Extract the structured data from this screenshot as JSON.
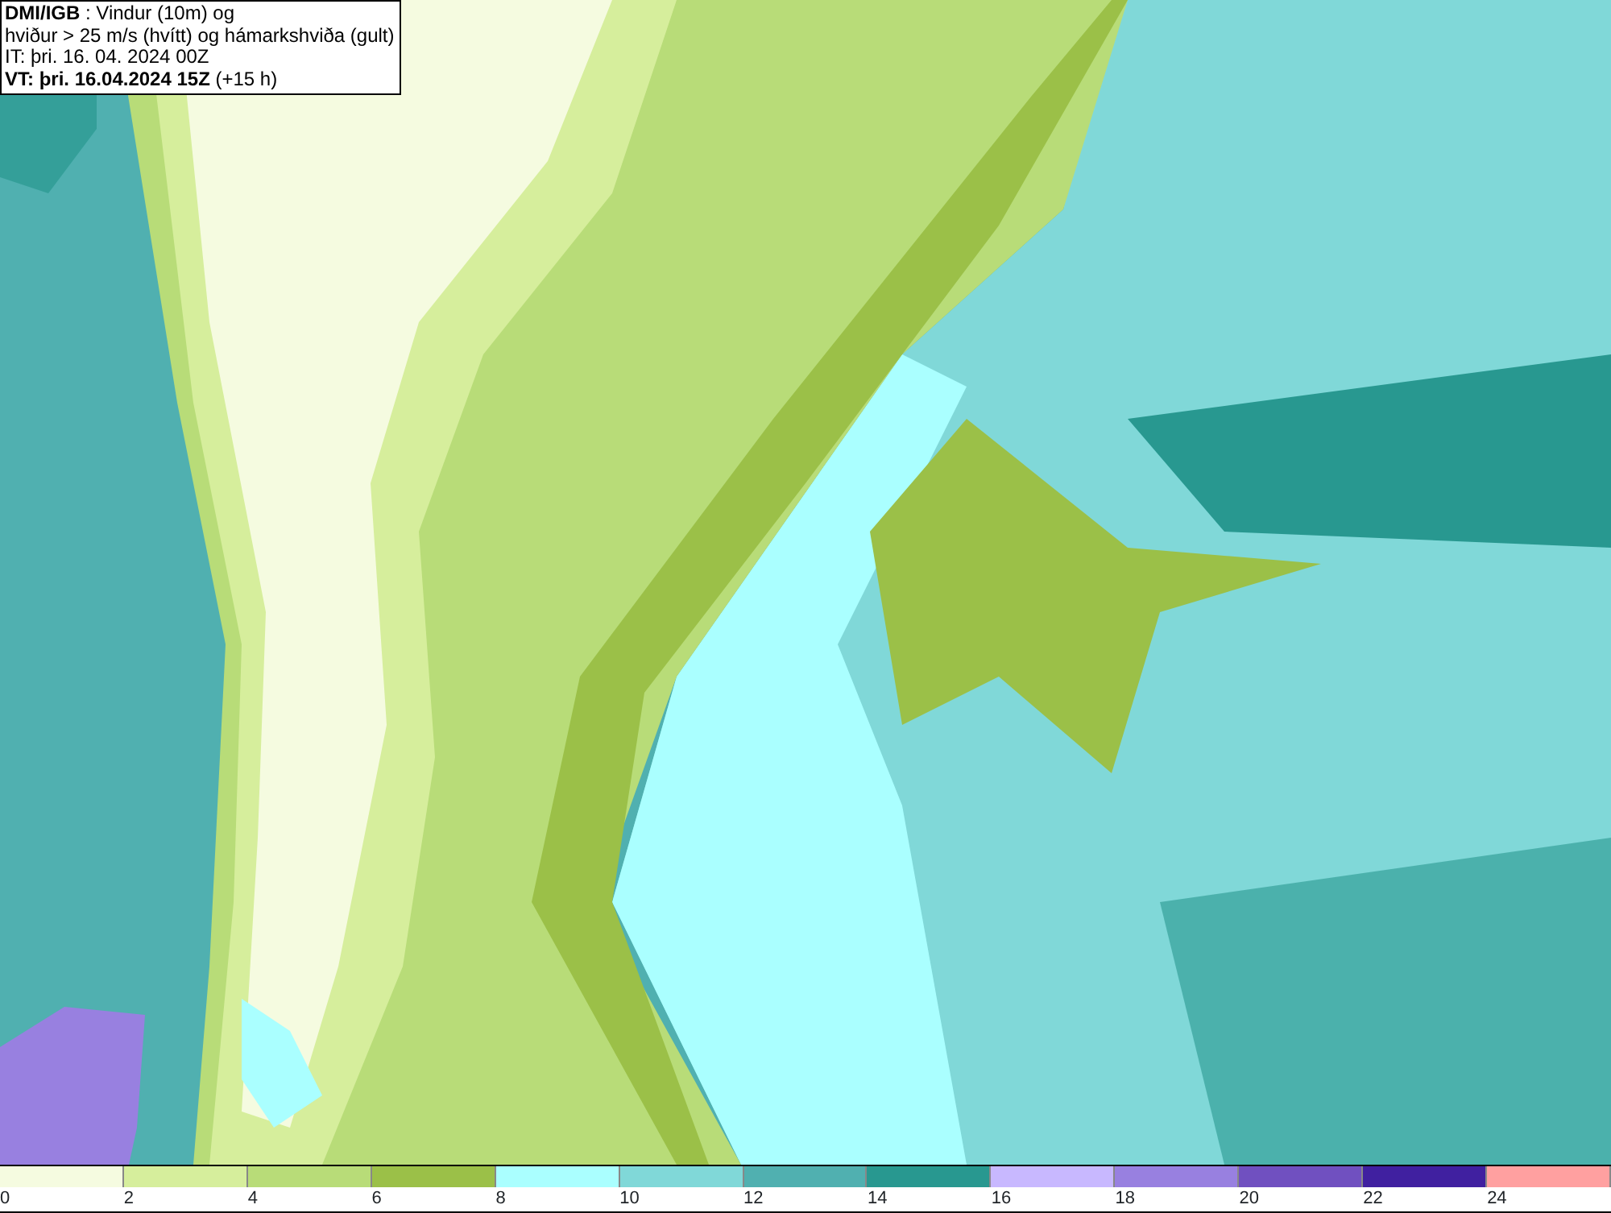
{
  "header": {
    "lines": [
      "**DMI/IGB** : Vindur (10m) og",
      "hviður > 25 m/s (hvítt) og hámarkshviða (gult)",
      "IT: þri. 16. 04. 2024 00Z",
      "**VT: þri. 16.04.2024 15Z** (+15 h)"
    ]
  },
  "legend": {
    "bins": [
      {
        "label": "0",
        "color": "#f5fbe0"
      },
      {
        "label": "2",
        "color": "#d6ee9c"
      },
      {
        "label": "4",
        "color": "#b8dc78"
      },
      {
        "label": "6",
        "color": "#9bc048"
      },
      {
        "label": "8",
        "color": "#aaffff"
      },
      {
        "label": "10",
        "color": "#80d8d8"
      },
      {
        "label": "12",
        "color": "#50b0b0"
      },
      {
        "label": "14",
        "color": "#289890"
      },
      {
        "label": "16",
        "color": "#c8b8ff"
      },
      {
        "label": "18",
        "color": "#9880e0"
      },
      {
        "label": "20",
        "color": "#7050c0"
      },
      {
        "label": "22",
        "color": "#4020a0"
      },
      {
        "label": "24",
        "color": "#ffa0a0"
      }
    ]
  }
}
